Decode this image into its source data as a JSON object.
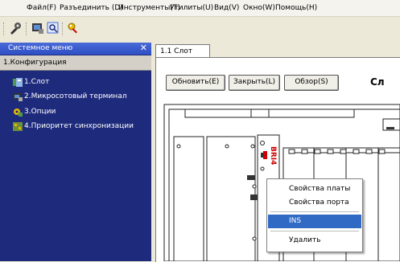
{
  "menubar": {
    "items": [
      "Файл(F)",
      "Разъединить (D)",
      "Инструменты(T)",
      "Утилиты(U)",
      "Вид(V)",
      "Окно(W)",
      "Помощь(H)"
    ]
  },
  "toolbar": {
    "icons": [
      "config-icon",
      "terminal-icon",
      "search-icon",
      "key-icon"
    ]
  },
  "sidebar": {
    "title": "Системное меню",
    "section": "1.Конфигурация",
    "items": [
      {
        "label": "1.Слот",
        "icon": "slot-icon"
      },
      {
        "label": "2.Микросотовый терминал",
        "icon": "terminal-icon"
      },
      {
        "label": "3.Опции",
        "icon": "options-icon"
      },
      {
        "label": "4.Приоритет синхронизации",
        "icon": "sync-icon"
      }
    ]
  },
  "tab": {
    "label": "1.1 Слот"
  },
  "actions": {
    "refresh": "Обновить(Е)",
    "close": "Закрыть(L)",
    "browse": "Обзор(S)"
  },
  "content": {
    "heading": "Сл",
    "board_label": "BRI4"
  },
  "context_menu": {
    "items": [
      "Свойства платы",
      "Свойства порта",
      "INS",
      "Удалить"
    ],
    "selected": "INS"
  },
  "colors": {
    "sidebar_bg": "#1e2b7c",
    "selection": "#316ac5",
    "board_label": "#cc0000"
  }
}
